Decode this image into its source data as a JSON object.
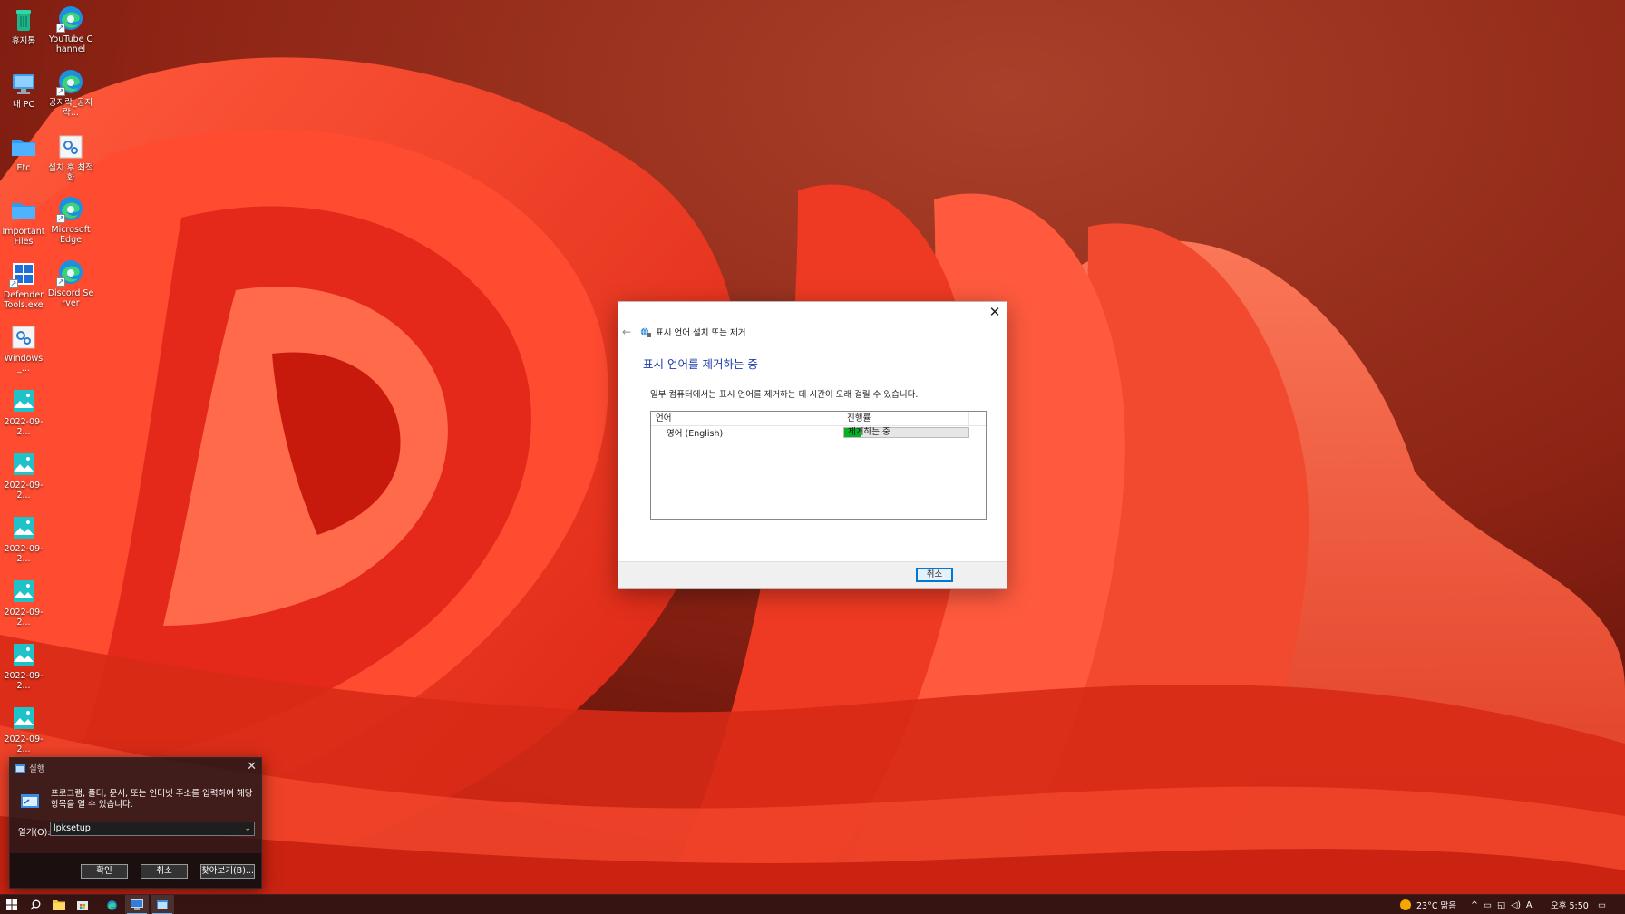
{
  "desktop": {
    "icons": [
      {
        "label": "휴지통",
        "icon": "recycle-bin-icon"
      },
      {
        "label": "YouTube Channel",
        "icon": "edge-icon"
      },
      {
        "label": "내 PC",
        "icon": "this-pc-icon"
      },
      {
        "label": "공지락_공지락...",
        "icon": "edge-icon"
      },
      {
        "label": "Etc",
        "icon": "folder-icon"
      },
      {
        "label": "설치 후 최적화",
        "icon": "settings-icon"
      },
      {
        "label": "Important Files",
        "icon": "folder-icon"
      },
      {
        "label": "Microsoft Edge",
        "icon": "edge-icon"
      },
      {
        "label": "Defender Tools.exe",
        "icon": "defender-icon"
      },
      {
        "label": "Discord Server",
        "icon": "edge-icon"
      },
      {
        "label": "Windows_...",
        "icon": "settings-icon"
      },
      {
        "label": "2022-09-2...",
        "icon": "image-file-icon"
      },
      {
        "label": "2022-09-2...",
        "icon": "image-file-icon"
      },
      {
        "label": "2022-09-2...",
        "icon": "image-file-icon"
      },
      {
        "label": "2022-09-2...",
        "icon": "image-file-icon"
      },
      {
        "label": "2022-09-2...",
        "icon": "image-file-icon"
      },
      {
        "label": "2022-09-2...",
        "icon": "image-file-icon"
      }
    ]
  },
  "dialog": {
    "nav_title": "표시 언어 설치 또는 제거",
    "heading": "표시 언어를 제거하는 중",
    "description": "일부 컴퓨터에서는 표시 언어를 제거하는 데 시간이 오래 걸릴 수 있습니다.",
    "columns": [
      "언어",
      "진행률"
    ],
    "rows": [
      {
        "language": "영어 (English)",
        "status": "제거하는 중",
        "progress": 0.13
      }
    ],
    "cancel_label": "취소"
  },
  "run_dialog": {
    "title": "실행",
    "message": "프로그램, 폴더, 문서, 또는 인터넷 주소를 입력하여 해당 항목을 열 수 있습니다.",
    "open_label": "열기(O):",
    "input_value": "lpksetup",
    "ok_label": "확인",
    "cancel_label": "취소",
    "browse_label": "찾아보기(B)..."
  },
  "taskbar": {
    "items": [
      "start-icon",
      "search-icon",
      "file-explorer-icon",
      "store-icon",
      "edge-icon",
      "language-setup-icon",
      "run-icon"
    ],
    "weather": "23°C 맑음",
    "ime": "A",
    "clock": "오후 5:50"
  },
  "colors": {
    "accent_blue": "#1e3ba8",
    "progress_green": "#06b025",
    "wallpaper_red": "#e8331b"
  }
}
